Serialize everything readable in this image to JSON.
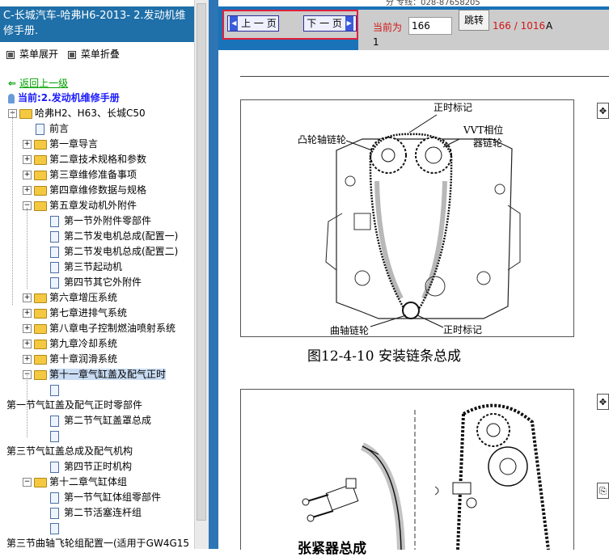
{
  "top_strip_text": "分 专线：028-87658205",
  "title": "C-长城汽车-哈弗H6-2013- 2.发动机维修手册.",
  "menu": {
    "expand": "菜单展开",
    "collapse": "菜单折叠"
  },
  "back_link": "返回上一级",
  "current": "当前:2.发动机维修手册",
  "tree": [
    {
      "label": "哈弗H2、H63、长城C50",
      "level": 0,
      "type": "folder",
      "pm": "−"
    },
    {
      "label": "前言",
      "level": 1,
      "type": "doc"
    },
    {
      "label": "第一章导言",
      "level": 1,
      "type": "folder",
      "pm": "+"
    },
    {
      "label": "第二章技术规格和参数",
      "level": 1,
      "type": "folder",
      "pm": "+"
    },
    {
      "label": "第三章维修准备事项",
      "level": 1,
      "type": "folder",
      "pm": "+"
    },
    {
      "label": "第四章维修数据与规格",
      "level": 1,
      "type": "folder",
      "pm": "+"
    },
    {
      "label": "第五章发动机外附件",
      "level": 1,
      "type": "folder",
      "pm": "−"
    },
    {
      "label": "第一节外附件零部件",
      "level": 2,
      "type": "doc"
    },
    {
      "label": "第二节发电机总成(配置一)",
      "level": 2,
      "type": "doc"
    },
    {
      "label": "第二节发电机总成(配置二)",
      "level": 2,
      "type": "doc"
    },
    {
      "label": "第三节起动机",
      "level": 2,
      "type": "doc"
    },
    {
      "label": "第四节其它外附件",
      "level": 2,
      "type": "doc"
    },
    {
      "label": "第六章增压系统",
      "level": 1,
      "type": "folder",
      "pm": "+"
    },
    {
      "label": "第七章进排气系统",
      "level": 1,
      "type": "folder",
      "pm": "+"
    },
    {
      "label": "第八章电子控制燃油喷射系统",
      "level": 1,
      "type": "folder",
      "pm": "+"
    },
    {
      "label": "第九章冷却系统",
      "level": 1,
      "type": "folder",
      "pm": "+"
    },
    {
      "label": "第十章润滑系统",
      "level": 1,
      "type": "folder",
      "pm": "+"
    },
    {
      "label": "第十一章气缸盖及配气正时",
      "level": 1,
      "type": "folder",
      "pm": "−",
      "selected": true
    },
    {
      "label": "",
      "level": 2,
      "type": "doc"
    },
    {
      "label": "第一节气缸盖及配气正时零部件",
      "level": -1,
      "type": "text"
    },
    {
      "label": "第二节气缸盖罩总成",
      "level": 2,
      "type": "doc"
    },
    {
      "label": "",
      "level": 2,
      "type": "doc"
    },
    {
      "label": "第三节气缸盖总成及配气机构",
      "level": -1,
      "type": "text"
    },
    {
      "label": "第四节正时机构",
      "level": 2,
      "type": "doc"
    },
    {
      "label": "第十二章气缸体组",
      "level": 1,
      "type": "folder",
      "pm": "−"
    },
    {
      "label": "第一节气缸体组零部件",
      "level": 2,
      "type": "doc"
    },
    {
      "label": "第二节活塞连杆组",
      "level": 2,
      "type": "doc"
    },
    {
      "label": "",
      "level": 2,
      "type": "doc"
    },
    {
      "label": "第三节曲轴飞轮组配置一(适用于GW4G15",
      "level": -1,
      "type": "text"
    }
  ],
  "toolbar": {
    "prev_label": "上 一 页",
    "next_label": "下 一 页",
    "current_label": "当前为",
    "page_value": "166",
    "jump_label": "跳转",
    "page_count": "166 / 1016",
    "page_suffix": "A",
    "page_line2": "1"
  },
  "figure1": {
    "labels": {
      "timing_mark_top": "正时标记",
      "cam_sprocket": "凸轮轴链轮",
      "vvt": "VVT相位",
      "vvt2": "器链轮",
      "crank_sprocket": "曲轴链轮",
      "timing_mark_bottom": "正时标记"
    },
    "caption": "图12-4-10  安装链条总成"
  },
  "figure2": {
    "labels": {
      "tensioner": "张紧器总成"
    }
  },
  "colors": {
    "title_bg": "#1f6fa8",
    "toolbar_bg": "#1a72b8",
    "accent_red": "#d41414",
    "link_green": "#00a000",
    "current_blue": "#1a1aff"
  }
}
